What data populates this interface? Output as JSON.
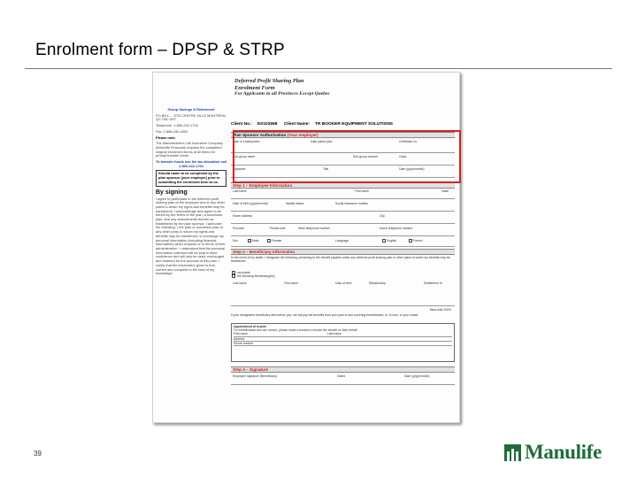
{
  "slide": {
    "title": "Enrolment form – DPSP & STRP",
    "page_number": "39"
  },
  "logo": {
    "text": "Manulife"
  },
  "form": {
    "heading_1": "Deferred Profit Sharing Plan",
    "heading_2": "Enrolment Form",
    "heading_3": "For Applicants in all Provinces Except Quebec",
    "left_col": {
      "company": "Group Savings & Retirement",
      "address": "PO BOX ... STN CENTRE-VILLE MONTREAL QC H3C 5H7",
      "telephone": "Telephone: 1-800-242-1704",
      "fax": "Fax: 1-866-430-4400",
      "please_note": "Please note.",
      "note_text": "The Manufacturers Life Insurance Company (Manulife Financial) requires the completed original enrolment forms at all times for prompt transfer funds.",
      "transfer_text": "To transfer funds use the tax allocation call 1-800-242-1704",
      "box_note": "Should name to be completed by the plan sponsor (your employer) prior to submitting the enrolment form to us.",
      "signing_heading": "By signing",
      "signing_text": "I agree to participate in the deferred profit sharing plan of the employer and in any other plans to which my rights and benefits may be transferred. I acknowledge and agree to be bound by the terms of the plan, a successor plan, and any amendments thereto as established by the plan sponsor. I authorize the following: • the plan or successor plan or any other party to whom my rights and benefits may be transferred, to exchange my personal information (including financial information) when required or in terms of their administration. I understand that the personal information collected will be kept in strict confidence and will only be used, exchanged and retained for the purpose of this plan. I certify that the information given is true, correct and complete to the best of my knowledge."
    },
    "client": {
      "no_label": "Client No.:",
      "no_value": "ES102598",
      "name_label": "Client Name:",
      "name_value": "TR BOOKER EQUIPMENT SOLUTIONS"
    },
    "sections": {
      "sponsor": "Plan Sponsor Authorization",
      "sponsor_sub": "(Your employer)",
      "step1": "Step 1 – Employee Information",
      "step2": "Step 2 – Beneficiary Information",
      "step3": "Step 3 – Signature"
    },
    "sponsor_fields": {
      "date_employment": "Date of employment",
      "date_joined": "Date joined plan",
      "certificate": "Certificate no.",
      "division": "Sub-group name",
      "sub_number": "Sub-group number",
      "class": "Class",
      "signature": "Signature",
      "title": "Title",
      "date": "Date (yyyy/mm/dd)"
    },
    "employee_fields": {
      "last_name": "Last name",
      "first_name": "First name",
      "initial": "Initial",
      "dob": "Date of birth (yyyy/mm/dd)",
      "marital": "Marital status",
      "sin": "Social insurance number",
      "home_address": "Home address",
      "city": "City",
      "province": "Province",
      "postal": "Postal code",
      "work_phone": "Work telephone number",
      "home_phone": "Home telephone number",
      "sex": "Sex",
      "male": "Male",
      "female": "Female",
      "language": "Language",
      "english": "English",
      "french": "French"
    },
    "beneficiary": {
      "intro": "In the event of my death, I designate the following, pertaining to the benefit payable under any deferred profit sharing plan or other plans to which my benefits may be transferred.",
      "opt1": "my estate",
      "opt2": "the following beneficiary(ies)",
      "col_last": "Last name",
      "col_first": "First name",
      "col_dob": "Date of birth",
      "col_rel": "Relationship",
      "col_pct": "Entitlement %",
      "total": "Must total 100%",
      "revocable": "If your designated beneficiary dies before you, we will pay the benefits from your plan to any surviving beneficiaries, or, if none, to your estate.",
      "trustee_h": "Appointment of trustee",
      "trustee_text": "For beneficiaries who are minors, please name a trustee to receive the benefit on their behalf.",
      "t_first": "First name",
      "t_last": "Last name",
      "t_addr": "Address",
      "t_phone": "Phone number"
    },
    "signature_fields": {
      "emp_sig": "Employee signature (Beneficiary)",
      "dated": "Dated",
      "date": "Date (yyyy/mm/dd)"
    }
  },
  "colors": {
    "highlight": "#d42323",
    "manulife_green": "#1f6b3a",
    "form_blue": "#1a3fa0"
  }
}
